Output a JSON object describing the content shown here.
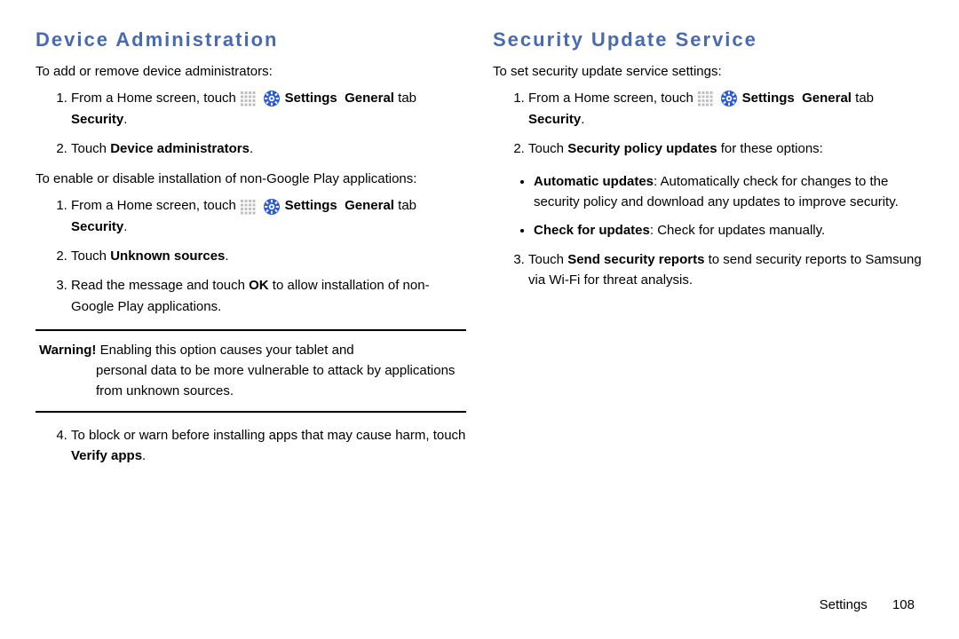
{
  "left": {
    "heading": "Device Administration",
    "intro1": "To add or remove device administrators:",
    "s1a_pre": "From a Home screen, touch ",
    "s1a_settings": " Settings ",
    "s1a_arrow1": " ",
    "s1a_general": "General",
    "s1a_tab": " tab ",
    "s1a_security": " Security",
    "s1a_period": ".",
    "s1b_pre": "Touch ",
    "s1b_item": "Device administrators",
    "s1b_period": ".",
    "intro2": "To enable or disable installation of non-Google Play applications:",
    "s2a_pre": "From a Home screen, touch ",
    "s2a_settings": " Settings ",
    "s2a_general": "General",
    "s2a_tab": " tab ",
    "s2a_security": " Security",
    "s2a_period": ".",
    "s2b_pre": "Touch ",
    "s2b_item": "Unknown sources",
    "s2b_period": ".",
    "s2c_pre": "Read the message and touch ",
    "s2c_ok": "OK",
    "s2c_post": " to allow installation of non-Google Play applications.",
    "warn_title": "Warning! ",
    "warn_body_first": "Enabling this option causes your tablet and ",
    "warn_body_rest": "personal data to be more vulnerable to attack by applications from unknown sources.",
    "s2d_pre": "To block or warn before installing apps that may cause harm, touch ",
    "s2d_item": "Verify apps",
    "s2d_period": "."
  },
  "right": {
    "heading": "Security Update Service",
    "intro1": "To set security update service settings:",
    "s1a_pre": "From a Home screen, touch ",
    "s1a_settings": " Settings ",
    "s1a_general": "General",
    "s1a_tab": " tab ",
    "s1a_security": " Security",
    "s1a_period": ".",
    "s1b_pre": "Touch ",
    "s1b_item": "Security policy updates",
    "s1b_post": " for these options:",
    "b1_label": "Automatic updates",
    "b1_body": ": Automatically check for changes to the security policy and download any updates to improve security.",
    "b2_label": "Check for updates",
    "b2_body": ": Check for updates manually.",
    "s1c_pre": "Touch ",
    "s1c_item": "Send security reports",
    "s1c_post": " to send security reports to Samsung via Wi-Fi for threat analysis."
  },
  "footer": {
    "section": "Settings",
    "page": "108"
  },
  "icons": {
    "grid": "apps-grid-icon",
    "gear": "settings-gear-icon"
  }
}
